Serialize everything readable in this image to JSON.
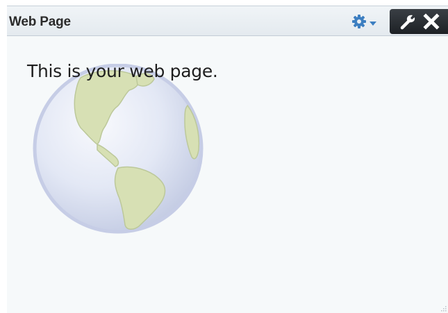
{
  "portlet": {
    "title": "Web Page",
    "header_icons": {
      "menu": "gear-icon",
      "menu_dropdown": "chevron-down-icon",
      "edit": "wrench-icon",
      "close": "close-icon"
    },
    "content": {
      "message": "This is your web page.",
      "image": "globe-icon"
    },
    "colors": {
      "gear_accent": "#3d7fc1",
      "header_dark": "#25292e",
      "globe_blue": "#c9d3ea",
      "land_green": "#d7e0b4"
    }
  }
}
